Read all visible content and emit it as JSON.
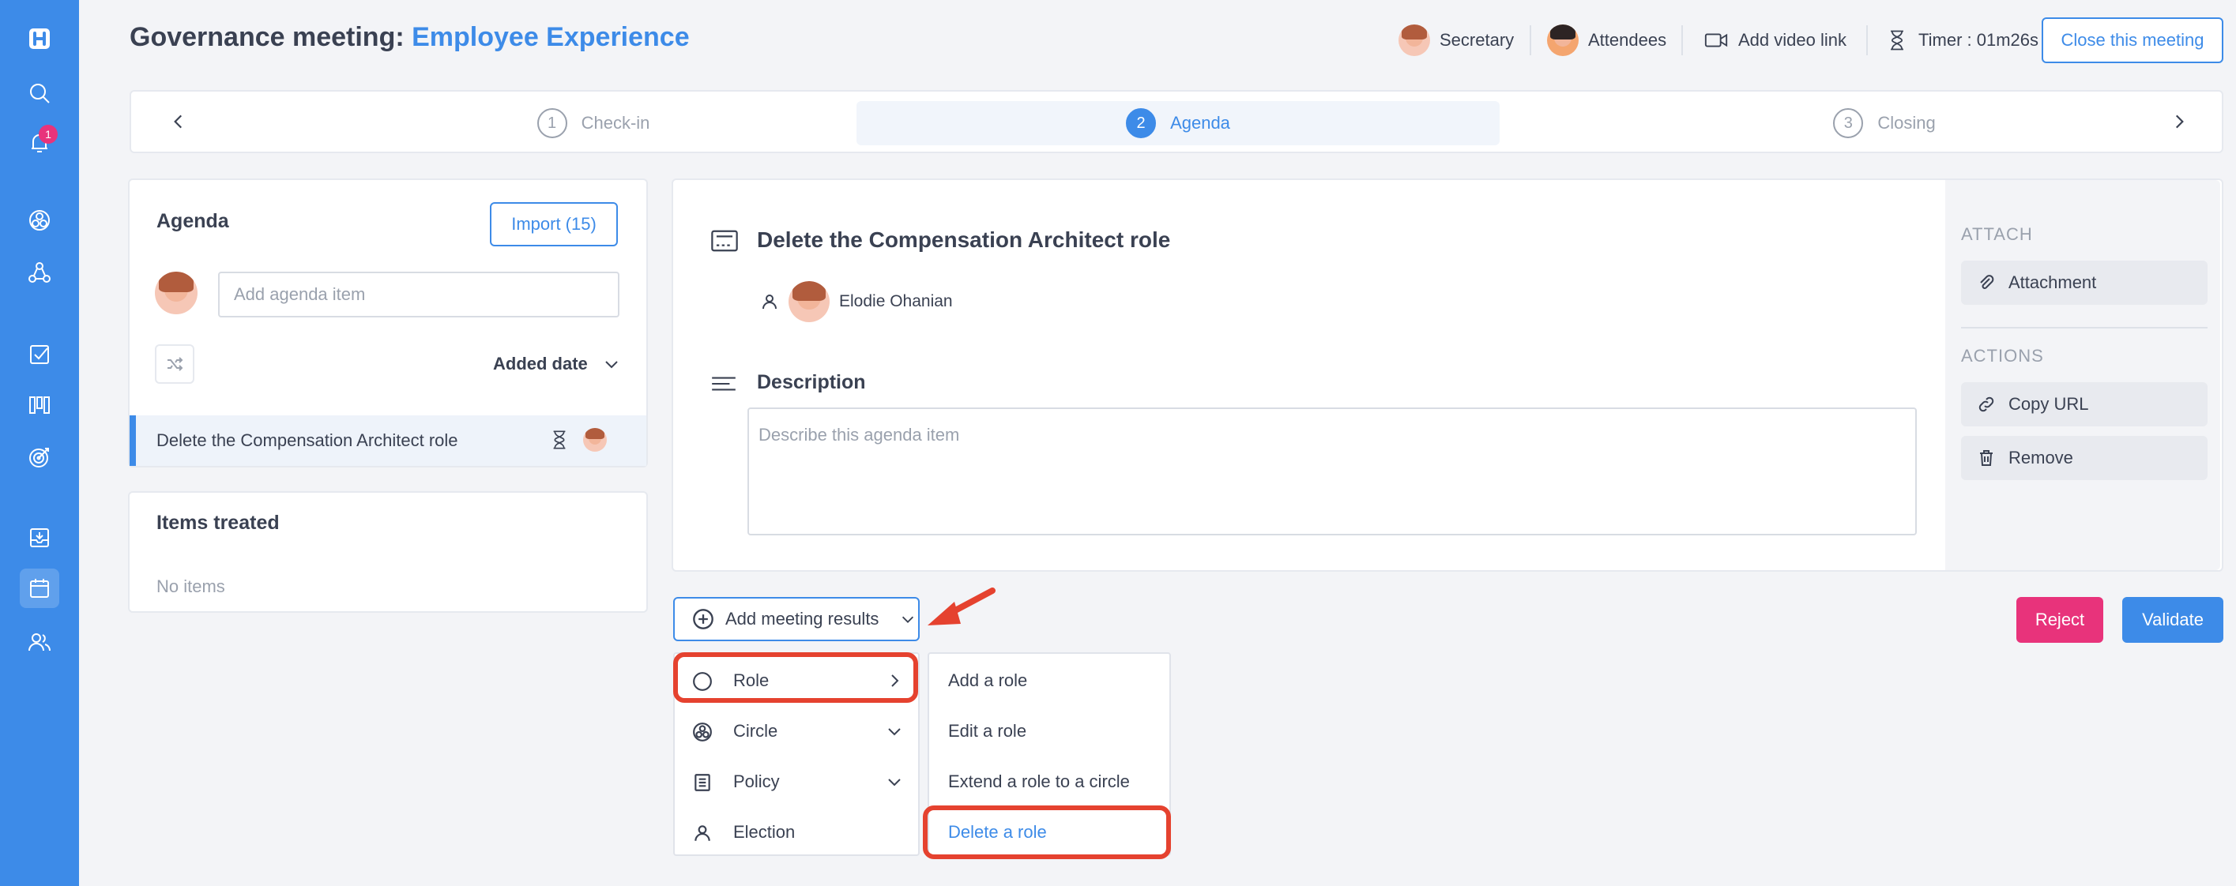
{
  "header": {
    "title_prefix": "Governance meeting:",
    "title_circle": "Employee Experience",
    "secretary_label": "Secretary",
    "attendees_label": "Attendees",
    "video_link_label": "Add video link",
    "timer_label": "Timer : 01m26s",
    "close_button": "Close this meeting"
  },
  "sidebar": {
    "notification_count": "1",
    "icons": [
      "logo-icon",
      "search-icon",
      "bell-icon",
      "circle-network-icon",
      "roles-icon",
      "checkbox-icon",
      "kanban-icon",
      "target-icon",
      "inbox-icon",
      "calendar-icon",
      "people-icon"
    ]
  },
  "stepper": {
    "steps": [
      {
        "number": "1",
        "label": "Check-in"
      },
      {
        "number": "2",
        "label": "Agenda"
      },
      {
        "number": "3",
        "label": "Closing"
      }
    ],
    "active_step": 2
  },
  "agenda": {
    "title": "Agenda",
    "import_button": "Import (15)",
    "input_placeholder": "Add agenda item",
    "sort_label": "Added date",
    "items": [
      {
        "label": "Delete the Compensation Architect role"
      }
    ]
  },
  "treated": {
    "title": "Items treated",
    "empty_label": "No items"
  },
  "detail": {
    "title": "Delete the Compensation Architect role",
    "owner_name": "Elodie Ohanian",
    "description_label": "Description",
    "description_placeholder": "Describe this agenda item"
  },
  "side_panel": {
    "attach_heading": "ATTACH",
    "attachment_button": "Attachment",
    "actions_heading": "ACTIONS",
    "copy_url_button": "Copy URL",
    "remove_button": "Remove"
  },
  "results": {
    "add_button": "Add meeting results",
    "reject_button": "Reject",
    "validate_button": "Validate",
    "menu": [
      {
        "label": "Role"
      },
      {
        "label": "Circle"
      },
      {
        "label": "Policy"
      },
      {
        "label": "Election"
      }
    ],
    "role_submenu": [
      {
        "label": "Add a role"
      },
      {
        "label": "Edit a role"
      },
      {
        "label": "Extend a role to a circle"
      },
      {
        "label": "Delete a role"
      }
    ]
  },
  "colors": {
    "brand_blue": "#3d8be8",
    "reject_pink": "#e8337b",
    "annotation_red": "#e5422f"
  }
}
